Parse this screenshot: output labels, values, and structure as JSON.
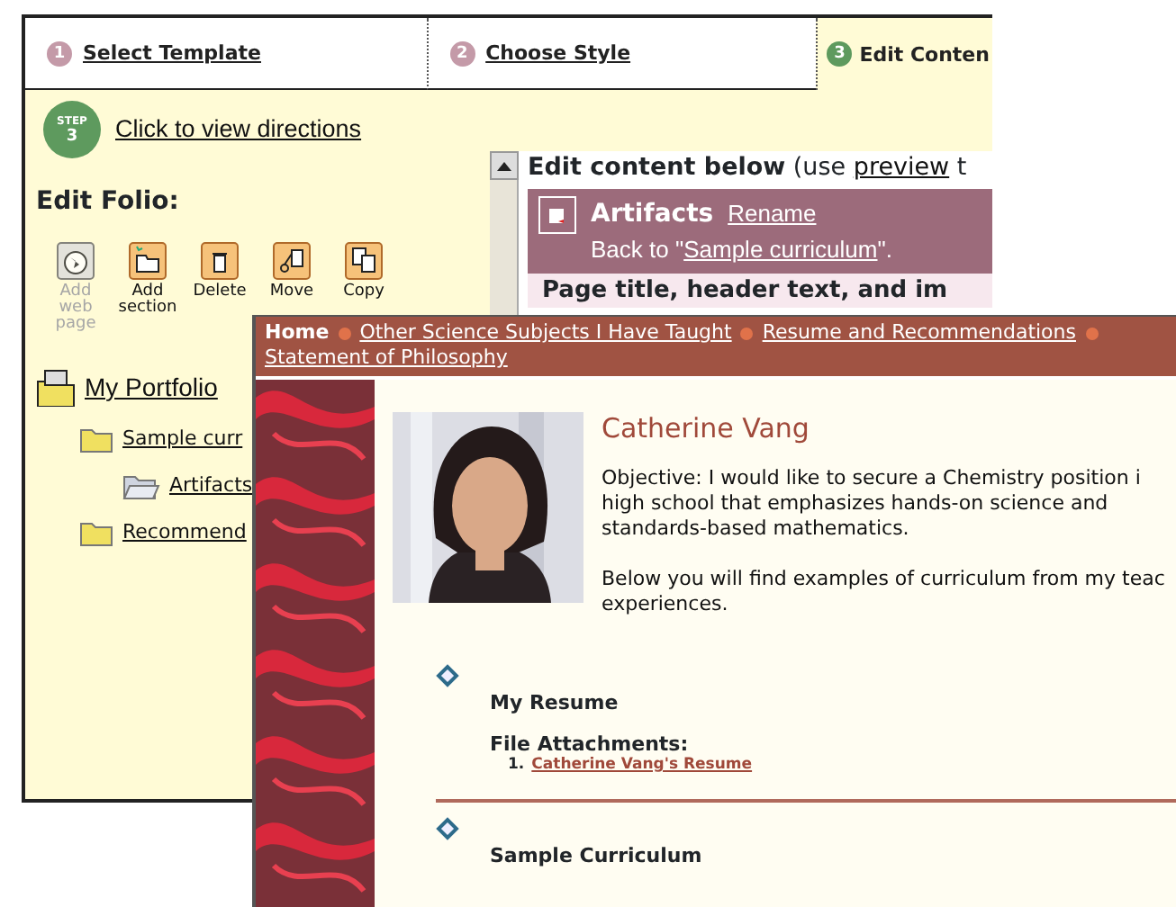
{
  "tabs": [
    {
      "number": "1",
      "label": "Select Template",
      "selected": false
    },
    {
      "number": "2",
      "label": "Choose Style",
      "selected": false
    },
    {
      "number": "3",
      "label": "Edit Conten",
      "selected": true
    }
  ],
  "step": {
    "badge_word": "STEP",
    "badge_number": "3",
    "link": "Click to view directions"
  },
  "edit_folio": {
    "heading": "Edit Folio:",
    "tools": [
      {
        "kind": "web",
        "label": "Add web page",
        "disabled": true
      },
      {
        "kind": "section",
        "label": "Add section",
        "disabled": false
      },
      {
        "kind": "delete",
        "label": "Delete",
        "disabled": false
      },
      {
        "kind": "move",
        "label": "Move",
        "disabled": false
      },
      {
        "kind": "copy",
        "label": "Copy",
        "disabled": false
      }
    ]
  },
  "tree": [
    {
      "kind": "root",
      "label": "My Portfolio",
      "children": [
        {
          "kind": "folder",
          "label": "Sample curr",
          "children": [
            {
              "kind": "open-folder",
              "label": "Artifacts"
            }
          ]
        },
        {
          "kind": "folder",
          "label": "Recommend"
        }
      ]
    }
  ],
  "editor": {
    "intro": "Edit content below",
    "hint_before": "(use ",
    "hint_link": "preview",
    "hint_after": " t",
    "section_title": "Artifacts",
    "rename_link": "Rename",
    "back_before": "Back to \"",
    "back_link": "Sample curriculum",
    "back_after": "\".",
    "page_title_text": "Page title, header text, and im"
  },
  "site": {
    "nav": [
      {
        "label": "Home",
        "current": true
      },
      {
        "label": "Other Science Subjects I Have Taught",
        "current": false
      },
      {
        "label": "Resume and Recommendations",
        "current": false
      },
      {
        "label": "Statement of Philosophy",
        "current": false
      }
    ],
    "name": "Catherine Vang",
    "paragraphs": [
      [
        "Objective: I would like to secure a Chemistry position i",
        "high school that emphasizes hands-on science and",
        "standards-based mathematics."
      ],
      [
        "Below you will find examples of curriculum from my teac",
        "experiences."
      ]
    ],
    "sections": [
      {
        "title": "My Resume",
        "attachments_heading": "File Attachments:",
        "attachments": [
          {
            "number": "1.",
            "label": "Catherine Vang's Resume"
          }
        ]
      },
      {
        "title": "Sample Curriculum"
      }
    ]
  }
}
